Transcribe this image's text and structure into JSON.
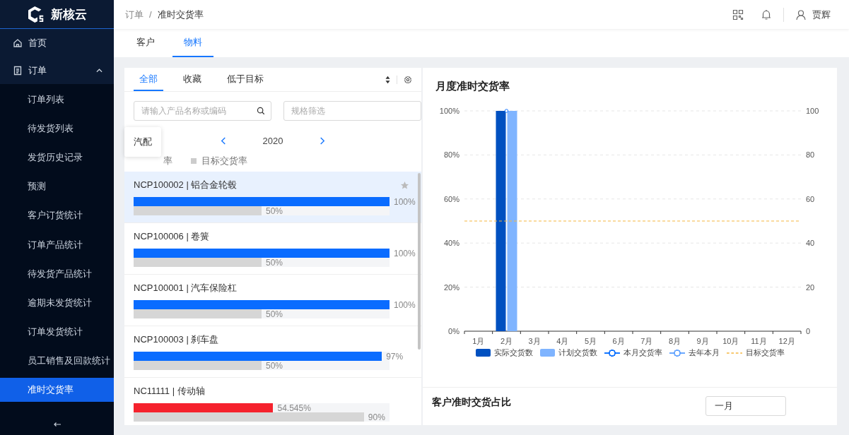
{
  "logo": {
    "text": "新核云"
  },
  "sidebar": {
    "items": [
      {
        "label": "首页",
        "selected": false
      },
      {
        "label": "订单",
        "selected": false,
        "expanded": true,
        "children": [
          {
            "label": "订单列表",
            "selected": false
          },
          {
            "label": "待发货列表",
            "selected": false
          },
          {
            "label": "发货历史记录",
            "selected": false
          },
          {
            "label": "预测",
            "selected": false
          },
          {
            "label": "客户订货统计",
            "selected": false
          },
          {
            "label": "订单产品统计",
            "selected": false
          },
          {
            "label": "待发货产品统计",
            "selected": false
          },
          {
            "label": "逾期未发货统计",
            "selected": false
          },
          {
            "label": "订单发货统计",
            "selected": false
          },
          {
            "label": "员工销售及回款统计",
            "selected": false
          },
          {
            "label": "准时交货率",
            "selected": true
          }
        ]
      }
    ]
  },
  "breadcrumb": {
    "items": [
      "订单",
      "准时交货率"
    ],
    "separator": "/"
  },
  "user": {
    "name": "贾辉"
  },
  "tabs": [
    {
      "label": "客户",
      "selected": false
    },
    {
      "label": "物料",
      "selected": true
    }
  ],
  "filter_tabs": [
    {
      "label": "全部",
      "selected": true
    },
    {
      "label": "收藏",
      "selected": false
    },
    {
      "label": "低于目标",
      "selected": false
    }
  ],
  "search": {
    "placeholder": "请输入产品名称或编码"
  },
  "spec_filter": {
    "placeholder": "规格筛选"
  },
  "year": "2020",
  "legend": [
    {
      "label": "率"
    },
    {
      "label": "目标交货率",
      "color": "#cccccc"
    }
  ],
  "tooltip": "汽配",
  "products": [
    {
      "name": "NCP100002 | 铝合金轮毂",
      "selected": true,
      "level": 1,
      "reading": "100%",
      "target": {
        "level": 0.5,
        "reading": "50%"
      }
    },
    {
      "name": "NCP100006 | 卷簧",
      "selected": false,
      "level": 1,
      "reading": "100%",
      "target": {
        "level": 0.5,
        "reading": "50%"
      }
    },
    {
      "name": "NCP100001 | 汽车保险杠",
      "selected": false,
      "level": 1,
      "reading": "100%",
      "target": {
        "level": 0.5,
        "reading": "50%"
      }
    },
    {
      "name": "NCP100003 | 刹车盘",
      "selected": false,
      "level": 0.97,
      "reading": "97%",
      "target": {
        "level": 0.5,
        "reading": "50%"
      }
    },
    {
      "name": "NC11111 | 传动轴",
      "selected": false,
      "level": 0.54545,
      "reading": "54.545%",
      "target": {
        "level": 0.9,
        "reading": "90%"
      }
    }
  ],
  "monthly": {
    "title": "月度准时交货率",
    "chart_data": {
      "type": "bar",
      "categories": [
        "1月",
        "2月",
        "3月",
        "4月",
        "5月",
        "6月",
        "7月",
        "8月",
        "9月",
        "10月",
        "11月",
        "12月"
      ],
      "yticks": [
        {
          "value": 0,
          "label": "0%"
        },
        {
          "value": 20,
          "label": "20%"
        },
        {
          "value": 40,
          "label": "40%"
        },
        {
          "value": 60,
          "label": "60%"
        },
        {
          "value": 80,
          "label": "80%"
        },
        {
          "value": 100,
          "label": "100%"
        }
      ],
      "ylim": [
        0,
        100
      ],
      "y2ticks": [
        0,
        20,
        40,
        60,
        80,
        100
      ],
      "y2lim": [
        0,
        100
      ],
      "grid": true,
      "series": [
        {
          "name": "实际交货数",
          "color": "#0050c0",
          "values": [
            0,
            100,
            0,
            0,
            0,
            0,
            0,
            0,
            0,
            0,
            0,
            0
          ]
        },
        {
          "name": "计划交货数",
          "color": "#7fb4ff",
          "values": [
            0,
            100,
            0,
            0,
            0,
            0,
            0,
            0,
            0,
            0,
            0,
            0
          ]
        }
      ],
      "legend": "bottom",
      "ref_lines": [
        {
          "axis": "y",
          "value": 50,
          "label": "目标交货率",
          "color": "#f5b640"
        }
      ]
    },
    "line_legend": [
      {
        "label": "本月交货率",
        "color": "#1677ff"
      },
      {
        "label": "去年本月",
        "color": "#6aa8ff"
      }
    ]
  },
  "customer_share": {
    "title": "客户准时交货占比",
    "month": "一月"
  }
}
